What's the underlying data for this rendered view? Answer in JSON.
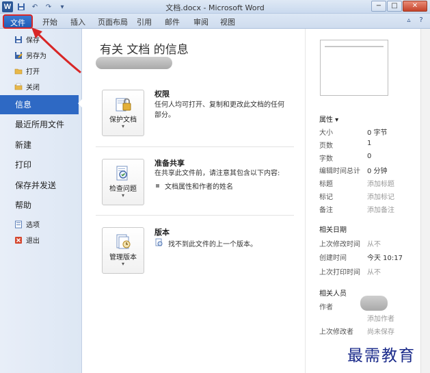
{
  "window": {
    "app_icon": "W",
    "title": "文档.docx - Microsoft Word",
    "controls": [
      "minimize-icon",
      "restore-icon",
      "close-icon"
    ]
  },
  "ribbon": {
    "file_tab": "文件",
    "tabs": [
      "开始",
      "插入",
      "页面布局",
      "引用",
      "邮件",
      "审阅",
      "视图"
    ]
  },
  "nav": {
    "small_items": [
      {
        "label": "保存",
        "icon": "save-icon"
      },
      {
        "label": "另存为",
        "icon": "save-as-icon"
      },
      {
        "label": "打开",
        "icon": "open-folder-icon"
      },
      {
        "label": "关闭",
        "icon": "close-folder-icon"
      }
    ],
    "big_items": [
      "信息",
      "最近所用文件",
      "新建",
      "打印",
      "保存并发送",
      "帮助"
    ],
    "bottom_items": [
      {
        "label": "选项",
        "icon": "options-icon"
      },
      {
        "label": "退出",
        "icon": "exit-icon"
      }
    ],
    "active": "信息"
  },
  "main": {
    "title": "有关 文档 的信息",
    "sections": [
      {
        "button_label": "保护文档",
        "icon": "protect-document-icon",
        "heading": "权限",
        "text_line1": "任何人均可打开、复制和更改此文档的任何",
        "text_line2": "部分。"
      },
      {
        "button_label": "检查问题",
        "icon": "check-issues-icon",
        "heading": "准备共享",
        "text_line1": "在共享此文件前，请注意其包含以下内容:",
        "bullet": "文档属性和作者的姓名"
      },
      {
        "button_label": "管理版本",
        "icon": "manage-versions-icon",
        "heading": "版本",
        "text_line1": "找不到此文件的上一个版本。"
      }
    ]
  },
  "properties": {
    "header": "属性 ▾",
    "rows": [
      {
        "label": "大小",
        "value": "0 字节",
        "muted": false
      },
      {
        "label": "页数",
        "value": "1",
        "muted": false
      },
      {
        "label": "字数",
        "value": "0",
        "muted": false
      },
      {
        "label": "编辑时间总计",
        "value": "0 分钟",
        "muted": false
      },
      {
        "label": "标题",
        "value": "添加标题",
        "muted": true
      },
      {
        "label": "标记",
        "value": "添加标记",
        "muted": true
      },
      {
        "label": "备注",
        "value": "添加备注",
        "muted": true
      }
    ],
    "dates_header": "相关日期",
    "dates": [
      {
        "label": "上次修改时间",
        "value": "从不"
      },
      {
        "label": "创建时间",
        "value": "今天 10:17"
      },
      {
        "label": "上次打印时间",
        "value": "从不"
      }
    ],
    "people_header": "相关人员",
    "author_label": "作者",
    "add_author": "添加作者",
    "last_modified_by_label": "上次修改者",
    "last_modified_by_value": "尚未保存"
  },
  "watermark": "最需教育",
  "colors": {
    "file_tab": "#1f5db7",
    "nav_active": "#2e69c4",
    "highlight_box": "#d82626",
    "watermark": "#1a2a8a"
  }
}
